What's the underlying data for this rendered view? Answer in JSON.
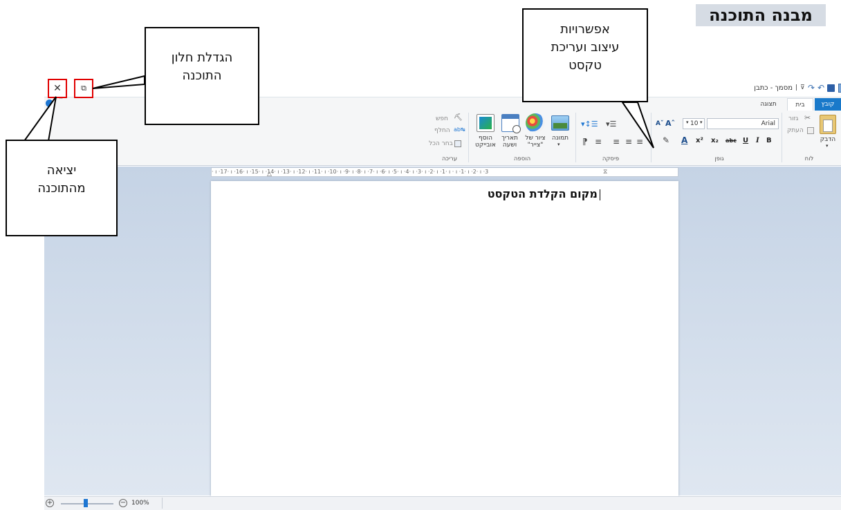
{
  "page": {
    "heading": "מבנה התוכנה"
  },
  "titlebar": {
    "doc_title": "מסמך - כתבן",
    "qat_separator": "|"
  },
  "tabs": {
    "file": "קובץ",
    "home": "בית",
    "view": "תצוגה"
  },
  "clipboard": {
    "paste": "הדבק",
    "cut": "גזור",
    "copy": "העתק",
    "group": "לוח"
  },
  "font": {
    "family": "Arial",
    "size": "10",
    "group": "גופן"
  },
  "paragraph": {
    "group": "פיסקה"
  },
  "insert": {
    "picture": "תמונה",
    "paint_line1": "ציור של",
    "paint_line2": "\"צייר\"",
    "datetime_line1": "תאריך",
    "datetime_line2": "ושעה",
    "object_line1": "הוסף",
    "object_line2": "אובייקט",
    "group": "הוספה"
  },
  "editing": {
    "find": "חפש",
    "replace": "החלף",
    "select_all": "בחר הכל",
    "group": "עריכה"
  },
  "ruler": {
    "text": "· ı ·17· ı ·16· ı ·15· ı ·14· ı ·13· ı ·12· ı ·11· ı ·10· ı ·9· ı ·8· ı ·7· ı ·6· ı ·5· ı ·4· ı ·3· ı ·2· ı ·1· ı · ı ·1· ı ·2· ı ·3"
  },
  "document": {
    "typed_text": "מקום הקלדת הטקסט"
  },
  "statusbar": {
    "zoom": "100%",
    "zoom_level": 1.0
  },
  "callouts": {
    "maximize": "הגדלת חלון\nהתוכנה",
    "formatting": "אפשרויות\nעיצוב ועריכת\nטקסט",
    "exit": "יציאה\nמהתוכנה"
  },
  "colors": {
    "heading_bg": "#d6dce4",
    "highlight_red": "#e00000",
    "workspace": "#c5d3e5",
    "ribbon": "#f5f6f7",
    "file_tab": "#1979ca"
  }
}
